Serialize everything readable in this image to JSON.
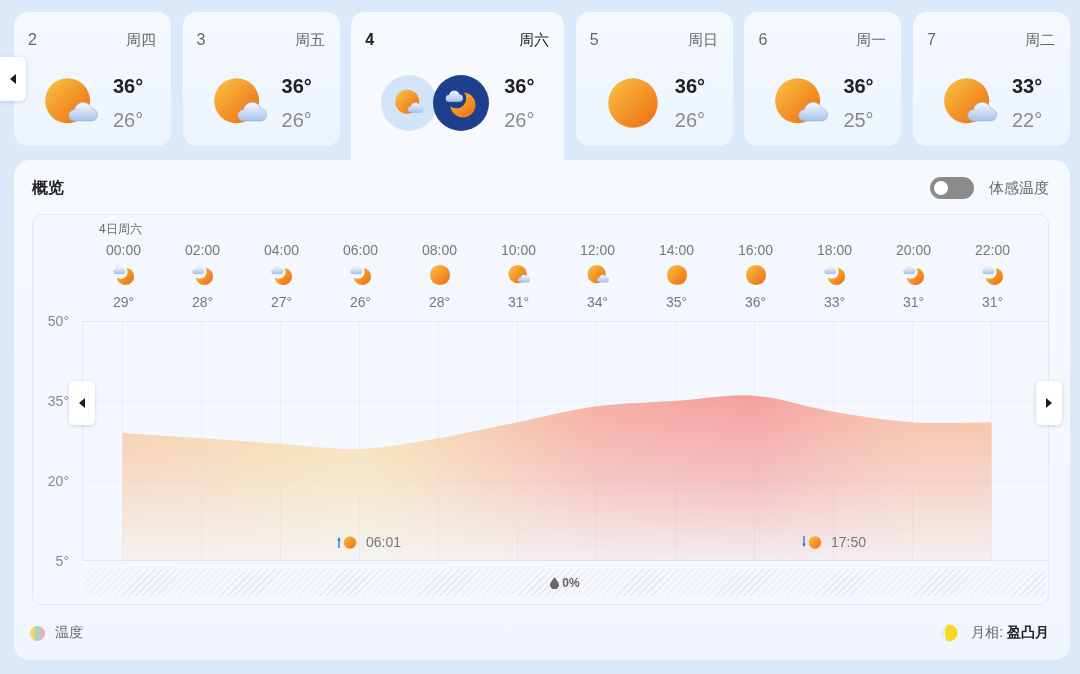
{
  "days": [
    {
      "day": "2",
      "weekday": "周四",
      "kind": "partly-cloudy",
      "high": "36°",
      "low": "26°",
      "selected": false
    },
    {
      "day": "3",
      "weekday": "周五",
      "kind": "partly-cloudy",
      "high": "36°",
      "low": "26°",
      "selected": false
    },
    {
      "day": "4",
      "weekday": "周六",
      "kind": "partly-cloudy",
      "night": {
        "kind": "night-partly-cloudy"
      },
      "high": "36°",
      "low": "26°",
      "selected": true
    },
    {
      "day": "5",
      "weekday": "周日",
      "kind": "sunny",
      "high": "36°",
      "low": "26°",
      "selected": false
    },
    {
      "day": "6",
      "weekday": "周一",
      "kind": "partly-cloudy",
      "high": "36°",
      "low": "25°",
      "selected": false
    },
    {
      "day": "7",
      "weekday": "周二",
      "kind": "partly-cloudy",
      "high": "33°",
      "low": "22°",
      "selected": false
    }
  ],
  "overview": {
    "title": "概览",
    "feels_like_toggle": {
      "label": "体感温度",
      "on": false
    },
    "date_label": "4日周六",
    "hours": [
      {
        "kind": "night-partly-cloudy",
        "temp": "29°"
      },
      {
        "kind": "night-partly-cloudy",
        "temp": "28°"
      },
      {
        "kind": "night-partly-cloudy",
        "temp": "27°"
      },
      {
        "kind": "night-partly-cloudy",
        "temp": "26°"
      },
      {
        "kind": "sunny",
        "temp": "28°"
      },
      {
        "kind": "partly-cloudy",
        "temp": "31°"
      },
      {
        "kind": "partly-cloudy",
        "temp": "34°"
      },
      {
        "kind": "sunny",
        "temp": "35°"
      },
      {
        "kind": "sunny",
        "temp": "36°"
      },
      {
        "kind": "night-partly-cloudy",
        "temp": "33°"
      },
      {
        "kind": "night-partly-cloudy",
        "temp": "31°"
      },
      {
        "kind": "night-partly-cloudy",
        "temp": "31°"
      }
    ],
    "chart_data": {
      "type": "area",
      "categories": [
        "00:00",
        "02:00",
        "04:00",
        "06:00",
        "08:00",
        "10:00",
        "12:00",
        "14:00",
        "16:00",
        "18:00",
        "20:00",
        "22:00"
      ],
      "values": [
        29,
        28,
        27,
        26,
        28,
        31,
        34,
        35,
        36,
        33,
        31,
        31
      ],
      "ylim": [
        5,
        50
      ],
      "yticks": [
        {
          "value": 5,
          "label": "5°"
        },
        {
          "value": 20,
          "label": "20°"
        },
        {
          "value": 35,
          "label": "35°"
        },
        {
          "value": 50,
          "label": "50°"
        }
      ],
      "grid": true
    },
    "sun_events": [
      {
        "kind": "sunrise",
        "time": "06:01"
      },
      {
        "kind": "sunset",
        "time": "17:50"
      }
    ],
    "precipitation": {
      "value": "0%"
    },
    "legend": {
      "label": "温度"
    },
    "moon_phase": {
      "text": "月相: **盈凸月**"
    }
  }
}
